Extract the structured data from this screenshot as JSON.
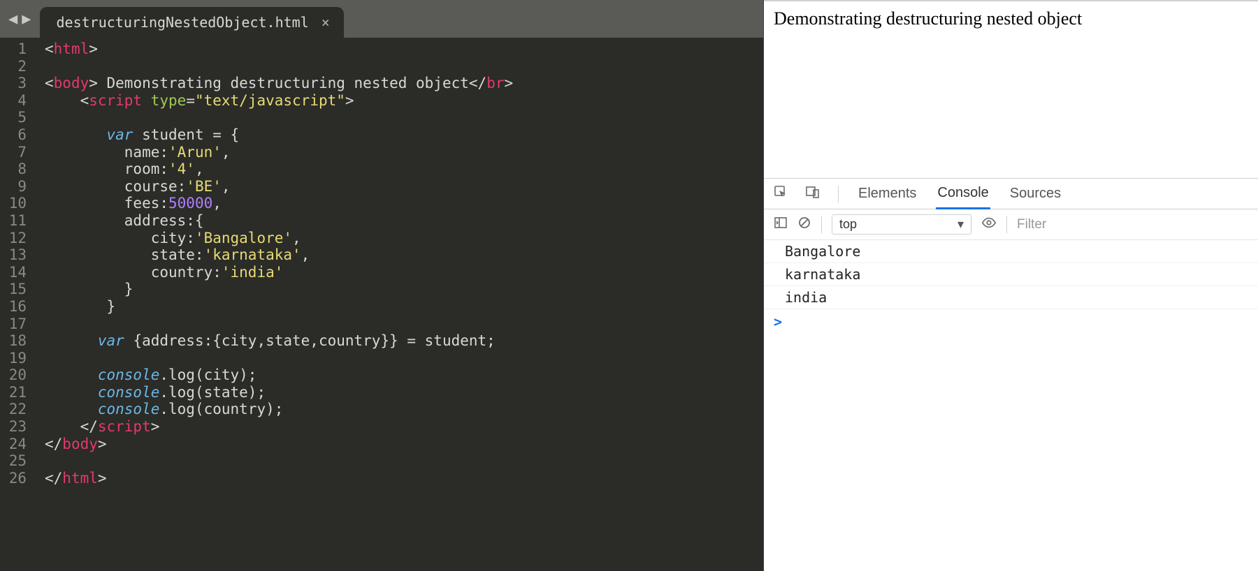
{
  "editor": {
    "tab_title": "destructuringNestedObject.html",
    "line_count": 26,
    "code_lines": [
      [
        [
          "p",
          "<"
        ],
        [
          "tg",
          "html"
        ],
        [
          "p",
          ">"
        ]
      ],
      [],
      [
        [
          "p",
          "<"
        ],
        [
          "tg",
          "body"
        ],
        [
          "p",
          "> Demonstrating destructuring nested object</"
        ],
        [
          "tg",
          "br"
        ],
        [
          "p",
          ">"
        ]
      ],
      [
        [
          "p",
          "    <"
        ],
        [
          "tg",
          "script "
        ],
        [
          "attr",
          "type"
        ],
        [
          "p",
          "="
        ],
        [
          "str",
          "\"text/javascript\""
        ],
        [
          "p",
          ">"
        ]
      ],
      [],
      [
        [
          "p",
          "       "
        ],
        [
          "kw",
          "var"
        ],
        [
          "p",
          " student = {"
        ]
      ],
      [
        [
          "p",
          "         name:"
        ],
        [
          "str",
          "'Arun'"
        ],
        [
          "p",
          ","
        ]
      ],
      [
        [
          "p",
          "         room:"
        ],
        [
          "str",
          "'4'"
        ],
        [
          "p",
          ","
        ]
      ],
      [
        [
          "p",
          "         course:"
        ],
        [
          "str",
          "'BE'"
        ],
        [
          "p",
          ","
        ]
      ],
      [
        [
          "p",
          "         fees:"
        ],
        [
          "num",
          "50000"
        ],
        [
          "p",
          ","
        ]
      ],
      [
        [
          "p",
          "         address:{"
        ]
      ],
      [
        [
          "p",
          "            city:"
        ],
        [
          "str",
          "'Bangalore'"
        ],
        [
          "p",
          ","
        ]
      ],
      [
        [
          "p",
          "            state:"
        ],
        [
          "str",
          "'karnataka'"
        ],
        [
          "p",
          ","
        ]
      ],
      [
        [
          "p",
          "            country:"
        ],
        [
          "str",
          "'india'"
        ]
      ],
      [
        [
          "p",
          "         }"
        ]
      ],
      [
        [
          "p",
          "       }"
        ]
      ],
      [],
      [
        [
          "p",
          "      "
        ],
        [
          "kw",
          "var"
        ],
        [
          "p",
          " {address:{city,state,country}} = student;"
        ]
      ],
      [],
      [
        [
          "p",
          "      "
        ],
        [
          "kw",
          "console"
        ],
        [
          "p",
          ".log(city);"
        ]
      ],
      [
        [
          "p",
          "      "
        ],
        [
          "kw",
          "console"
        ],
        [
          "p",
          ".log(state);"
        ]
      ],
      [
        [
          "p",
          "      "
        ],
        [
          "kw",
          "console"
        ],
        [
          "p",
          ".log(country);"
        ]
      ],
      [
        [
          "p",
          "    </"
        ],
        [
          "tg",
          "script"
        ],
        [
          "p",
          ">"
        ]
      ],
      [
        [
          "p",
          "</"
        ],
        [
          "tg",
          "body"
        ],
        [
          "p",
          ">"
        ]
      ],
      [],
      [
        [
          "p",
          "</"
        ],
        [
          "tg",
          "html"
        ],
        [
          "p",
          ">"
        ]
      ]
    ]
  },
  "browser": {
    "page_text": "Demonstrating destructuring nested object"
  },
  "devtools": {
    "tabs": {
      "elements": "Elements",
      "console": "Console",
      "sources": "Sources"
    },
    "context": "top",
    "filter_placeholder": "Filter",
    "console_output": [
      "Bangalore",
      "karnataka",
      "india"
    ],
    "prompt": ">"
  }
}
